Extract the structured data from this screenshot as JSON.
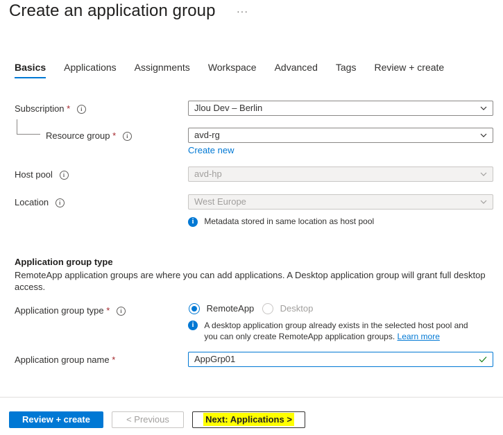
{
  "header": {
    "title": "Create an application group",
    "more": "···"
  },
  "tabs": [
    "Basics",
    "Applications",
    "Assignments",
    "Workspace",
    "Advanced",
    "Tags",
    "Review + create"
  ],
  "form": {
    "subscription": {
      "label": "Subscription",
      "required": "*",
      "value": "Jlou Dev – Berlin"
    },
    "resource_group": {
      "label": "Resource group",
      "required": "*",
      "value": "avd-rg",
      "create_new": "Create new"
    },
    "host_pool": {
      "label": "Host pool",
      "value": "avd-hp"
    },
    "location": {
      "label": "Location",
      "value": "West Europe",
      "note": "Metadata stored in same location as host pool"
    }
  },
  "app_group_type": {
    "heading": "Application group type",
    "description_line1": "RemoteApp application groups are where you can add applications. A Desktop application group will grant full desktop",
    "description_line2": "access.",
    "type_label": "Application group type",
    "required": "*",
    "options": [
      "RemoteApp",
      "Desktop"
    ],
    "selected": "RemoteApp",
    "note_line1": "A desktop application group already exists in the selected host pool and",
    "note_line2": "you can only create RemoteApp application groups.",
    "learn_more": "Learn more",
    "name_label": "Application group name",
    "name_value": "AppGrp01"
  },
  "footer": {
    "review_create": "Review + create",
    "previous": "< Previous",
    "next": "Next: Applications >"
  },
  "colors": {
    "accent": "#0078d4",
    "required": "#a4262c",
    "valid": "#107c10",
    "highlight": "#ffff00"
  },
  "icons": {
    "info": "info-icon",
    "chevron": "chevron-down-icon",
    "check": "checkmark-icon"
  }
}
